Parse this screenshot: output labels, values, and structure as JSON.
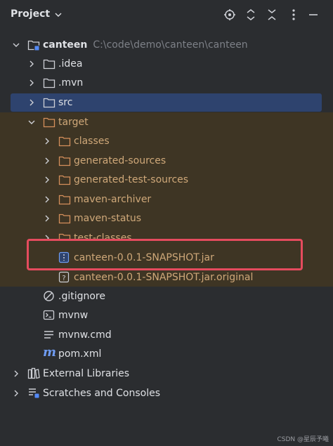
{
  "header": {
    "title": "Project",
    "icons": [
      "locate-icon",
      "expand-all-icon",
      "collapse-all-icon",
      "options-icon",
      "hide-icon"
    ]
  },
  "tree": {
    "root": {
      "name": "canteen",
      "path": "C:\\code\\demo\\canteen\\canteen"
    },
    "idea": ".idea",
    "mvn": ".mvn",
    "src": "src",
    "target": "target",
    "classes": "classes",
    "generated_sources": "generated-sources",
    "generated_test_sources": "generated-test-sources",
    "maven_archiver": "maven-archiver",
    "maven_status": "maven-status",
    "test_classes": "test-classes",
    "jar": "canteen-0.0.1-SNAPSHOT.jar",
    "jar_original": "canteen-0.0.1-SNAPSHOT.jar.original",
    "gitignore": ".gitignore",
    "mvnw": "mvnw",
    "mvnw_cmd": "mvnw.cmd",
    "pom": "pom.xml",
    "external_libraries": "External Libraries",
    "scratches": "Scratches and Consoles"
  },
  "watermark": "CSDN @星辰予曦",
  "colors": {
    "background": "#2b2d30",
    "selected_row": "#2e436e",
    "excluded_folder_bg": "#3e3524",
    "excluded_text": "#cfa879",
    "highlight": "#e54b5e"
  }
}
